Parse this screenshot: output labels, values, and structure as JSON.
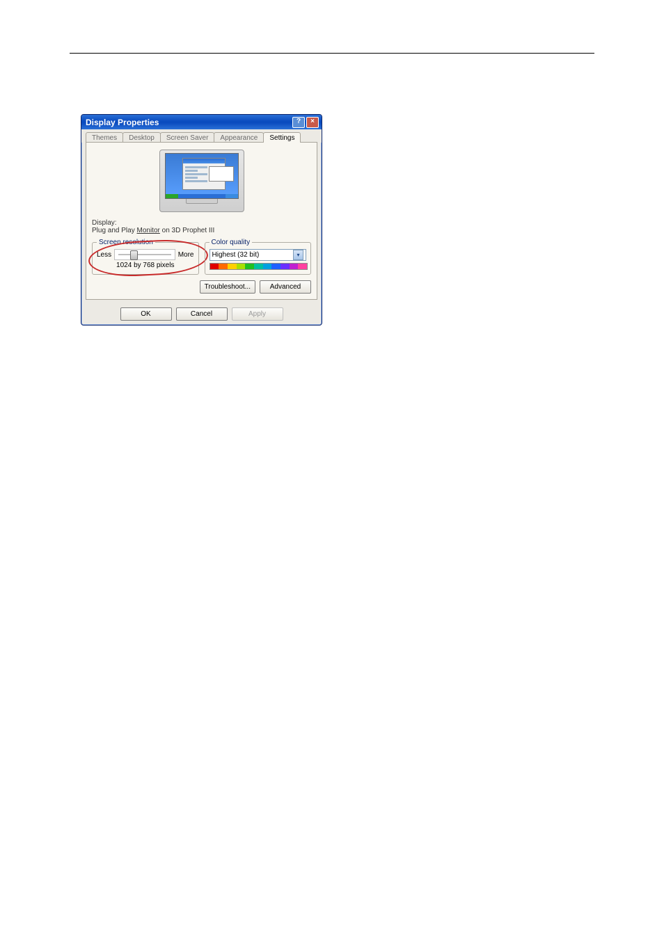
{
  "window": {
    "title": "Display Properties",
    "help_tooltip": "?",
    "close_tooltip": "×"
  },
  "tabs": {
    "themes": "Themes",
    "desktop": "Desktop",
    "screensaver": "Screen Saver",
    "appearance": "Appearance",
    "settings": "Settings"
  },
  "display": {
    "label": "Display:",
    "monitor_word": "Monitor",
    "value_prefix": "Plug and Play ",
    "value_suffix": " on 3D Prophet III"
  },
  "resolution": {
    "legend": "Screen resolution",
    "less": "Less",
    "more": "More",
    "value": "1024 by 768 pixels"
  },
  "color_quality": {
    "legend": "Color quality",
    "value": "Highest (32 bit)"
  },
  "buttons": {
    "troubleshoot": "Troubleshoot...",
    "advanced": "Advanced",
    "ok": "OK",
    "cancel": "Cancel",
    "apply": "Apply"
  }
}
